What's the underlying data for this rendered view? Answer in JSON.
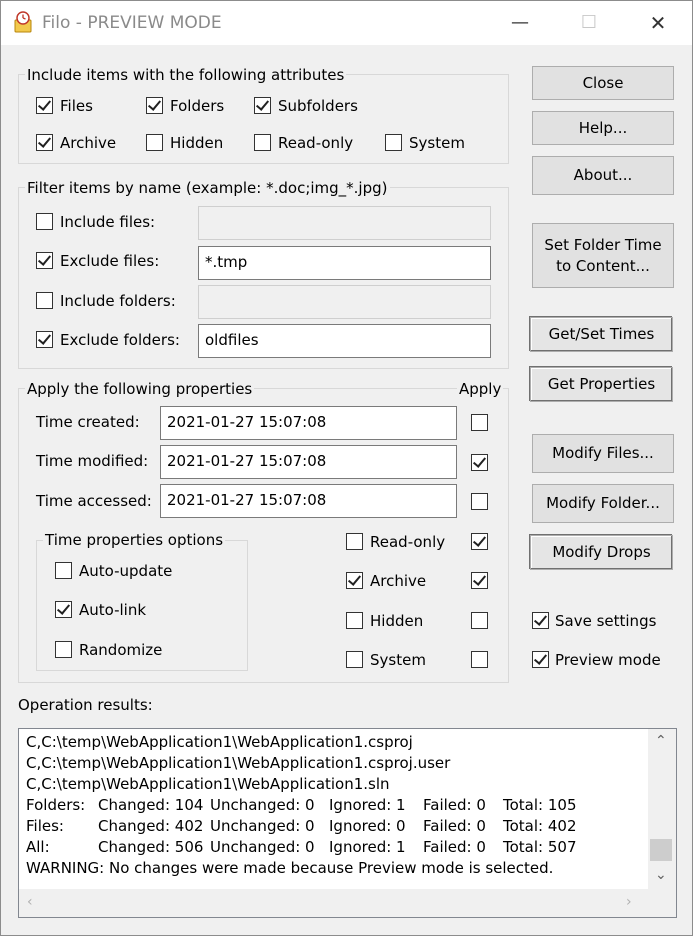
{
  "window": {
    "title": "Filo - PREVIEW MODE"
  },
  "attributes": {
    "legend": "Include items with the following attributes",
    "files": {
      "label": "Files",
      "checked": true
    },
    "folders": {
      "label": "Folders",
      "checked": true
    },
    "subfolders": {
      "label": "Subfolders",
      "checked": true
    },
    "archive": {
      "label": "Archive",
      "checked": true
    },
    "hidden": {
      "label": "Hidden",
      "checked": false
    },
    "readonly": {
      "label": "Read-only",
      "checked": false
    },
    "system": {
      "label": "System",
      "checked": false
    }
  },
  "filter": {
    "legend": "Filter items by name (example: *.doc;img_*.jpg)",
    "include_files": {
      "label": "Include files:",
      "checked": false,
      "value": ""
    },
    "exclude_files": {
      "label": "Exclude files:",
      "checked": true,
      "value": "*.tmp"
    },
    "include_folders": {
      "label": "Include folders:",
      "checked": false,
      "value": ""
    },
    "exclude_folders": {
      "label": "Exclude folders:",
      "checked": true,
      "value": "oldfiles"
    }
  },
  "props": {
    "legend": "Apply the following properties",
    "apply_header": "Apply",
    "time_created": {
      "label": "Time created:",
      "value": "2021-01-27 15:07:08",
      "apply": false
    },
    "time_modified": {
      "label": "Time modified:",
      "value": "2021-01-27 15:07:08",
      "apply": true
    },
    "time_accessed": {
      "label": "Time accessed:",
      "value": "2021-01-27 15:07:08",
      "apply": false
    },
    "time_options": {
      "legend": "Time properties options",
      "auto_update": {
        "label": "Auto-update",
        "checked": false
      },
      "auto_link": {
        "label": "Auto-link",
        "checked": true
      },
      "randomize": {
        "label": "Randomize",
        "checked": false
      }
    },
    "readonly": {
      "label": "Read-only",
      "checked": false,
      "apply": true
    },
    "archive": {
      "label": "Archive",
      "checked": true,
      "apply": true
    },
    "hidden": {
      "label": "Hidden",
      "checked": false,
      "apply": false
    },
    "system": {
      "label": "System",
      "checked": false,
      "apply": false
    }
  },
  "buttons": {
    "close": "Close",
    "help": "Help...",
    "about": "About...",
    "set_folder_time_1": "Set Folder Time",
    "set_folder_time_2": "to Content...",
    "get_set_times": "Get/Set Times",
    "get_properties": "Get Properties",
    "modify_files": "Modify Files...",
    "modify_folder": "Modify Folder...",
    "modify_drops": "Modify Drops"
  },
  "settings": {
    "save_settings": {
      "label": "Save settings",
      "checked": true
    },
    "preview_mode": {
      "label": "Preview mode",
      "checked": true
    }
  },
  "results": {
    "label": "Operation results:",
    "lines": [
      "C,C:\\temp\\WebApplication1\\WebApplication1.csproj",
      "C,C:\\temp\\WebApplication1\\WebApplication1.csproj.user",
      "C,C:\\temp\\WebApplication1\\WebApplication1.sln"
    ],
    "summary": [
      {
        "k": "Folders:",
        "changed": "Changed: 104",
        "unchanged": "Unchanged: 0",
        "ignored": "Ignored: 1",
        "failed": "Failed: 0",
        "total": "Total: 105"
      },
      {
        "k": "Files:",
        "changed": "Changed: 402",
        "unchanged": "Unchanged: 0",
        "ignored": "Ignored: 0",
        "failed": "Failed: 0",
        "total": "Total: 402"
      },
      {
        "k": "All:",
        "changed": "Changed: 506",
        "unchanged": "Unchanged: 0",
        "ignored": "Ignored: 1",
        "failed": "Failed: 0",
        "total": "Total: 507"
      }
    ],
    "warning": "WARNING: No changes were made because Preview mode is selected."
  }
}
